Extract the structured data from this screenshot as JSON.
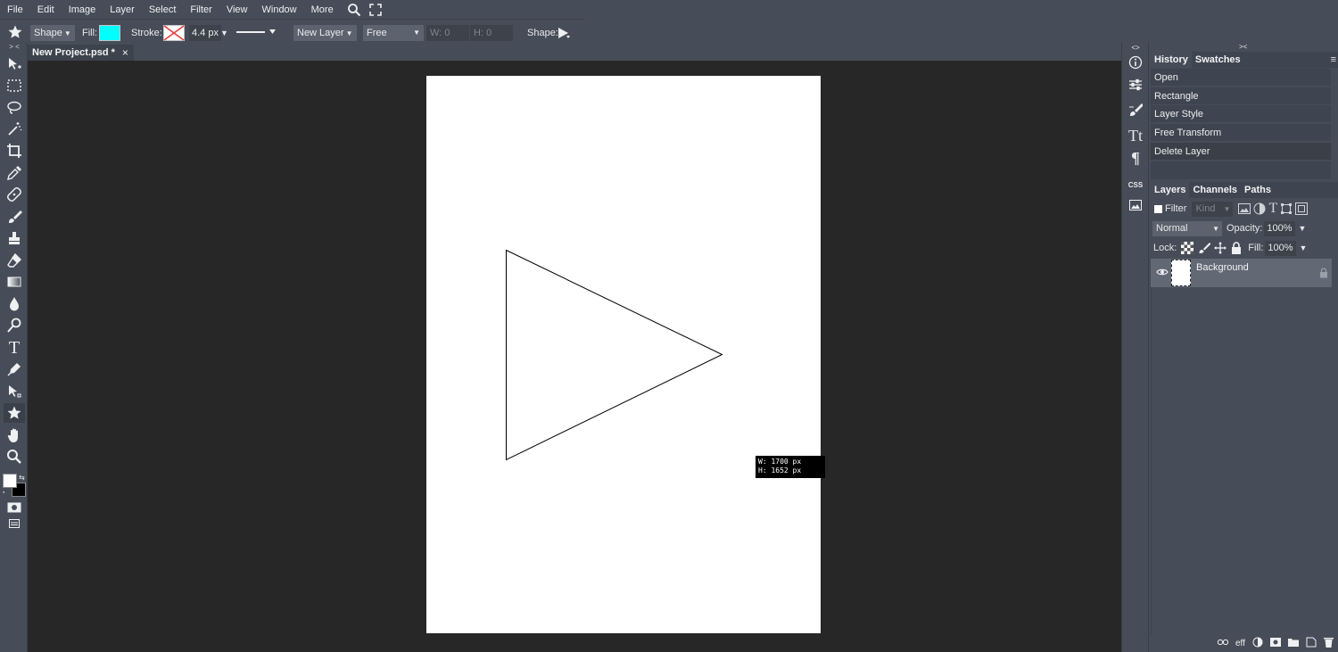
{
  "menu": [
    "File",
    "Edit",
    "Image",
    "Layer",
    "Select",
    "Filter",
    "View",
    "Window",
    "More"
  ],
  "options": {
    "shape_dropdown": "Shape",
    "fill_label": "Fill:",
    "fill_color": "#00ffff",
    "stroke_label": "Stroke:",
    "stroke_width": "4.4 px",
    "layer_dropdown": "New Layer",
    "mode_dropdown": "Free",
    "w_label": "W:",
    "w_value": "0",
    "h_label": "H:",
    "h_value": "0",
    "shape_label": "Shape:"
  },
  "tabs": {
    "doc_title": "New Project.psd *",
    "close": "×"
  },
  "tooltip": {
    "w": "W: 1700 px",
    "h": "H: 1652 px"
  },
  "mini_panel": {
    "collapse": "<>",
    "css": "CSS"
  },
  "panel1": {
    "collapse": "><",
    "tabs": [
      "History",
      "Swatches"
    ],
    "menu": "≡",
    "history": [
      "Open",
      "Rectangle",
      "Layer Style",
      "Free Transform",
      "Delete Layer"
    ]
  },
  "panel2": {
    "tabs": [
      "Layers",
      "Channels",
      "Paths"
    ],
    "filter_label": "Filter",
    "kind_placeholder": "Kind",
    "blend_mode": "Normal",
    "opacity_label": "Opacity:",
    "opacity_value": "100%",
    "lock_label": "Lock:",
    "fill_label": "Fill:",
    "fill_value": "100%",
    "layer_name": "Background",
    "footer_eff": "eff"
  },
  "colors": {
    "accent_fill": "#00ffff",
    "ui_bg": "#474d58",
    "workspace_bg": "#272727"
  }
}
